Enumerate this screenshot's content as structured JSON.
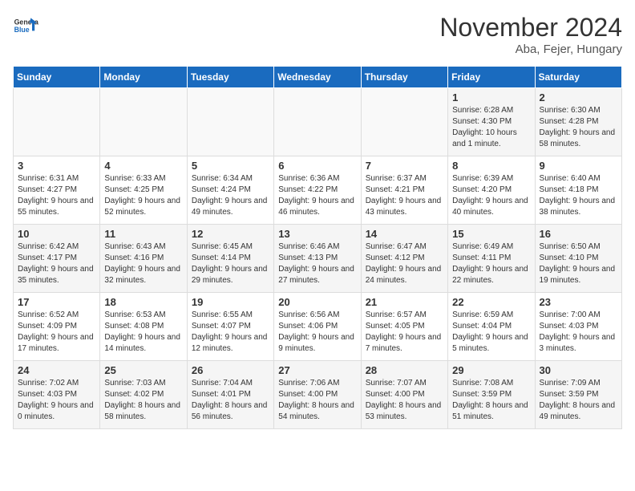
{
  "header": {
    "logo_line1": "General",
    "logo_line2": "Blue",
    "month": "November 2024",
    "location": "Aba, Fejer, Hungary"
  },
  "days_of_week": [
    "Sunday",
    "Monday",
    "Tuesday",
    "Wednesday",
    "Thursday",
    "Friday",
    "Saturday"
  ],
  "weeks": [
    [
      {
        "day": "",
        "info": ""
      },
      {
        "day": "",
        "info": ""
      },
      {
        "day": "",
        "info": ""
      },
      {
        "day": "",
        "info": ""
      },
      {
        "day": "",
        "info": ""
      },
      {
        "day": "1",
        "info": "Sunrise: 6:28 AM\nSunset: 4:30 PM\nDaylight: 10 hours and 1 minute."
      },
      {
        "day": "2",
        "info": "Sunrise: 6:30 AM\nSunset: 4:28 PM\nDaylight: 9 hours and 58 minutes."
      }
    ],
    [
      {
        "day": "3",
        "info": "Sunrise: 6:31 AM\nSunset: 4:27 PM\nDaylight: 9 hours and 55 minutes."
      },
      {
        "day": "4",
        "info": "Sunrise: 6:33 AM\nSunset: 4:25 PM\nDaylight: 9 hours and 52 minutes."
      },
      {
        "day": "5",
        "info": "Sunrise: 6:34 AM\nSunset: 4:24 PM\nDaylight: 9 hours and 49 minutes."
      },
      {
        "day": "6",
        "info": "Sunrise: 6:36 AM\nSunset: 4:22 PM\nDaylight: 9 hours and 46 minutes."
      },
      {
        "day": "7",
        "info": "Sunrise: 6:37 AM\nSunset: 4:21 PM\nDaylight: 9 hours and 43 minutes."
      },
      {
        "day": "8",
        "info": "Sunrise: 6:39 AM\nSunset: 4:20 PM\nDaylight: 9 hours and 40 minutes."
      },
      {
        "day": "9",
        "info": "Sunrise: 6:40 AM\nSunset: 4:18 PM\nDaylight: 9 hours and 38 minutes."
      }
    ],
    [
      {
        "day": "10",
        "info": "Sunrise: 6:42 AM\nSunset: 4:17 PM\nDaylight: 9 hours and 35 minutes."
      },
      {
        "day": "11",
        "info": "Sunrise: 6:43 AM\nSunset: 4:16 PM\nDaylight: 9 hours and 32 minutes."
      },
      {
        "day": "12",
        "info": "Sunrise: 6:45 AM\nSunset: 4:14 PM\nDaylight: 9 hours and 29 minutes."
      },
      {
        "day": "13",
        "info": "Sunrise: 6:46 AM\nSunset: 4:13 PM\nDaylight: 9 hours and 27 minutes."
      },
      {
        "day": "14",
        "info": "Sunrise: 6:47 AM\nSunset: 4:12 PM\nDaylight: 9 hours and 24 minutes."
      },
      {
        "day": "15",
        "info": "Sunrise: 6:49 AM\nSunset: 4:11 PM\nDaylight: 9 hours and 22 minutes."
      },
      {
        "day": "16",
        "info": "Sunrise: 6:50 AM\nSunset: 4:10 PM\nDaylight: 9 hours and 19 minutes."
      }
    ],
    [
      {
        "day": "17",
        "info": "Sunrise: 6:52 AM\nSunset: 4:09 PM\nDaylight: 9 hours and 17 minutes."
      },
      {
        "day": "18",
        "info": "Sunrise: 6:53 AM\nSunset: 4:08 PM\nDaylight: 9 hours and 14 minutes."
      },
      {
        "day": "19",
        "info": "Sunrise: 6:55 AM\nSunset: 4:07 PM\nDaylight: 9 hours and 12 minutes."
      },
      {
        "day": "20",
        "info": "Sunrise: 6:56 AM\nSunset: 4:06 PM\nDaylight: 9 hours and 9 minutes."
      },
      {
        "day": "21",
        "info": "Sunrise: 6:57 AM\nSunset: 4:05 PM\nDaylight: 9 hours and 7 minutes."
      },
      {
        "day": "22",
        "info": "Sunrise: 6:59 AM\nSunset: 4:04 PM\nDaylight: 9 hours and 5 minutes."
      },
      {
        "day": "23",
        "info": "Sunrise: 7:00 AM\nSunset: 4:03 PM\nDaylight: 9 hours and 3 minutes."
      }
    ],
    [
      {
        "day": "24",
        "info": "Sunrise: 7:02 AM\nSunset: 4:03 PM\nDaylight: 9 hours and 0 minutes."
      },
      {
        "day": "25",
        "info": "Sunrise: 7:03 AM\nSunset: 4:02 PM\nDaylight: 8 hours and 58 minutes."
      },
      {
        "day": "26",
        "info": "Sunrise: 7:04 AM\nSunset: 4:01 PM\nDaylight: 8 hours and 56 minutes."
      },
      {
        "day": "27",
        "info": "Sunrise: 7:06 AM\nSunset: 4:00 PM\nDaylight: 8 hours and 54 minutes."
      },
      {
        "day": "28",
        "info": "Sunrise: 7:07 AM\nSunset: 4:00 PM\nDaylight: 8 hours and 53 minutes."
      },
      {
        "day": "29",
        "info": "Sunrise: 7:08 AM\nSunset: 3:59 PM\nDaylight: 8 hours and 51 minutes."
      },
      {
        "day": "30",
        "info": "Sunrise: 7:09 AM\nSunset: 3:59 PM\nDaylight: 8 hours and 49 minutes."
      }
    ]
  ]
}
